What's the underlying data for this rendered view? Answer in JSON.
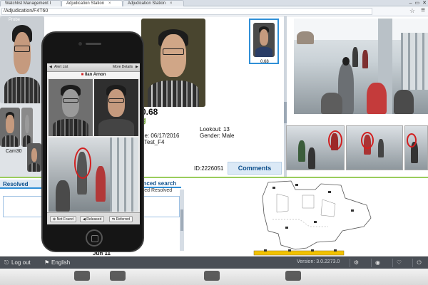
{
  "browser": {
    "tabs": [
      {
        "label": "Watchlist Management I"
      },
      {
        "label": "Adjudication Station"
      },
      {
        "label": "Adjudication Station"
      }
    ],
    "address": "/Adjudication/F4T60"
  },
  "left_column": {
    "top_label": "Probe",
    "cam_label": "Cam30"
  },
  "detail": {
    "score": "0.68",
    "lookout_label": "Lookout:",
    "lookout_value": "13",
    "date_label": "ue:",
    "date_value": "06/17/2016",
    "gender_label": "Gender:",
    "gender_value": "Male",
    "test_label": "Test_F4",
    "id_text": "ID:2226051",
    "comments_label": "Comments"
  },
  "thumbnail": {
    "score": "0.68"
  },
  "lower_panel": {
    "resolved_label": "Resolved",
    "advanced_search": "anced search",
    "col_labels": "rded  Resolved",
    "date_label": "Jun 11"
  },
  "phone": {
    "alert_list": "Alert List",
    "more_details": "More Details",
    "person_name": "Ilan Arnon",
    "actions": [
      {
        "label": "Not Found"
      },
      {
        "label": "Released"
      },
      {
        "label": "Referred"
      }
    ]
  },
  "bottom": {
    "logout": "Log out",
    "language": "English",
    "version": "Version: 3.0.2273.0"
  },
  "colors": {
    "accent": "#2f8fd7",
    "success_green": "#9acd5c",
    "alert_red": "#d21f1f"
  }
}
